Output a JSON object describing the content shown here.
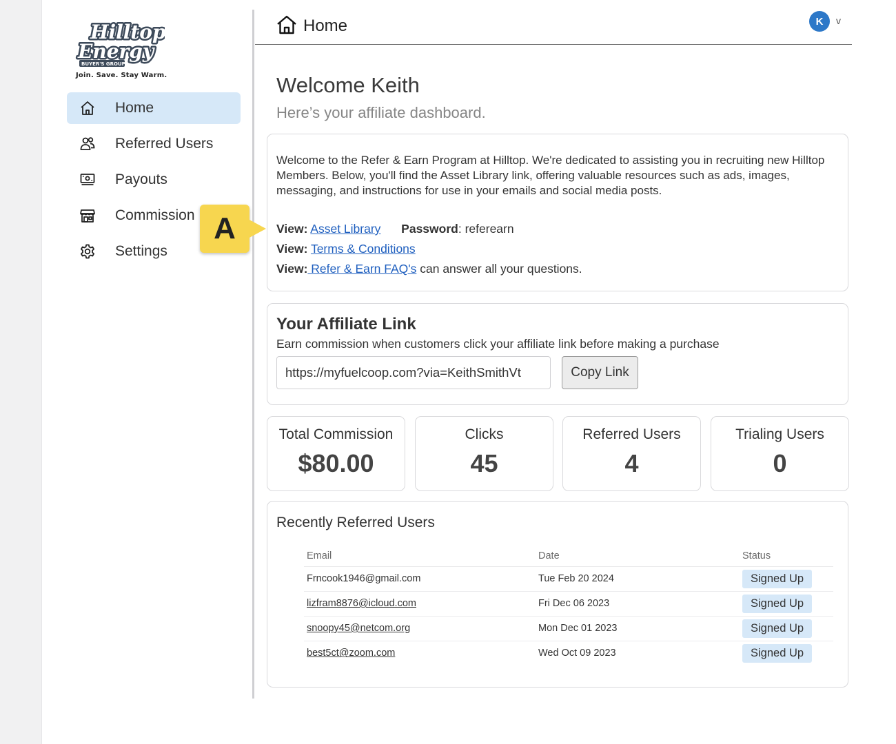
{
  "brand": {
    "logo_text_1": "Hilltop",
    "logo_text_2": "Energy",
    "logo_text_3": "BUYER'S GROUP",
    "tagline": "Join. Save. Stay Warm.",
    "accent_color": "#2d78c8",
    "active_bg": "#d6e8f8"
  },
  "sidebar": {
    "items": [
      {
        "label": "Home",
        "icon": "home-icon"
      },
      {
        "label": "Referred Users",
        "icon": "users-icon"
      },
      {
        "label": "Payouts",
        "icon": "money-icon"
      },
      {
        "label": "Commission",
        "icon": "store-icon"
      },
      {
        "label": "Settings",
        "icon": "gear-icon"
      }
    ]
  },
  "callout": {
    "label": "A",
    "color": "#f7d64f"
  },
  "header": {
    "title": "Home",
    "avatar_initial": "K",
    "caret": "v"
  },
  "welcome": {
    "title": "Welcome Keith",
    "subtitle": "Here’s your affiliate dashboard."
  },
  "intro": {
    "text": "Welcome to the Refer & Earn Program at Hilltop. We're dedicated to assisting you in recruiting new Hilltop Members. Below, you'll find the Asset Library link, offering valuable resources such as ads, images, messaging, and instructions for use in your emails and social media posts.",
    "view_label": "View:",
    "asset_library": "Asset Library",
    "password_label": "Password",
    "password_value": ": referearn",
    "terms": "Terms & Conditions",
    "faq": " Refer & Earn FAQ's",
    "faq_suffix": " can answer all your questions."
  },
  "affiliate": {
    "title": "Your Affiliate Link",
    "description": "Earn commission when customers click your affiliate link before making a purchase",
    "link": "https://myfuelcoop.com?via=KeithSmithVt",
    "copy_label": "Copy Link"
  },
  "stats": [
    {
      "label": "Total Commission",
      "value": "$80.00"
    },
    {
      "label": "Clicks",
      "value": "45"
    },
    {
      "label": "Referred Users",
      "value": "4"
    },
    {
      "label": "Trialing Users",
      "value": "0"
    }
  ],
  "recent": {
    "title": "Recently Referred Users",
    "columns": [
      "Email",
      "Date",
      "Status"
    ],
    "rows": [
      {
        "email": "Frncook1946@gmail.com",
        "date": "Tue Feb 20 2024",
        "status": "Signed Up"
      },
      {
        "email": "lizfram8876@icloud.com",
        "date": "Fri Dec 06 2023",
        "status": "Signed Up"
      },
      {
        "email": "snoopy45@netcom.org",
        "date": "Mon Dec 01 2023",
        "status": "Signed Up"
      },
      {
        "email": "best5ct@zoom.com",
        "date": "Wed Oct 09 2023",
        "status": "Signed Up"
      }
    ]
  }
}
